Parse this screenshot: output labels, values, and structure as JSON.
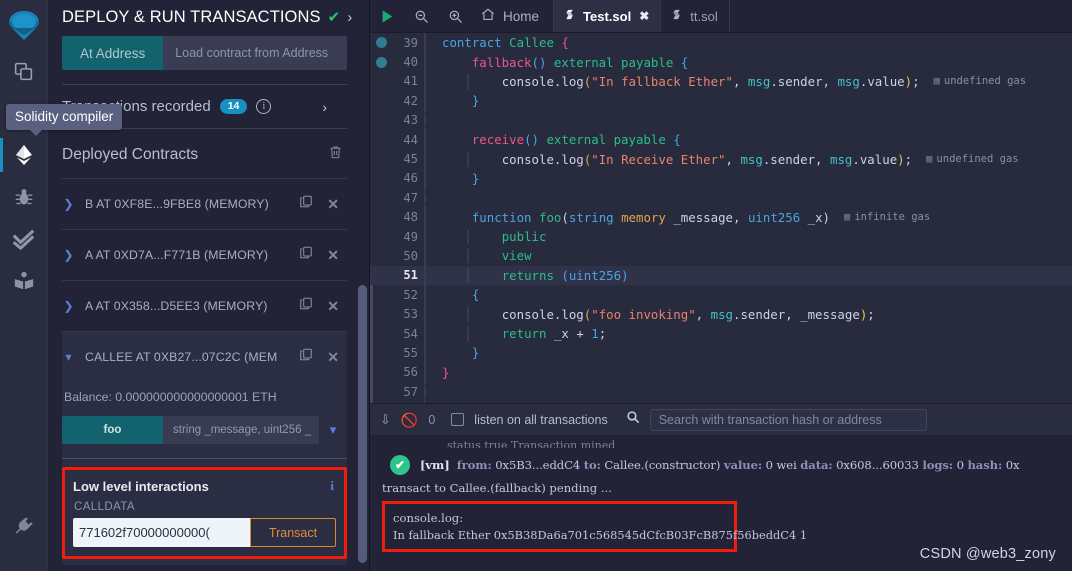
{
  "theme": {
    "accent_teal": "#13636f",
    "accent_blue": "#1790c4",
    "highlight_red": "#f01c0e",
    "success_green": "#2fc48b",
    "panel_bg": "#222336",
    "rail_bg": "#2a2c3f",
    "editor_bg": "#282a3e",
    "transact_orange": "#e08b3d"
  },
  "rail": {
    "logo": "remix-logo-icon",
    "items": [
      {
        "name": "file-explorer-icon",
        "title": "File explorers",
        "active": false,
        "badge": null
      },
      {
        "name": "solidity-compiler-icon",
        "title": "Solidity compiler",
        "active": false,
        "badge": "check"
      },
      {
        "name": "deploy-run-icon",
        "title": "Deploy & run transactions",
        "active": true,
        "badge": null
      },
      {
        "name": "debugger-bug-icon",
        "title": "Debugger",
        "active": false,
        "badge": null
      },
      {
        "name": "unit-testing-checks-icon",
        "title": "Solidity unit testing",
        "active": false,
        "badge": null
      },
      {
        "name": "documentation-book-icon",
        "title": "Documentation",
        "active": false,
        "badge": null
      },
      {
        "name": "plugin-manager-plug-icon",
        "title": "Plugin manager",
        "active": false,
        "badge": null
      }
    ],
    "tooltip": "Solidity compiler"
  },
  "sidebar": {
    "title": "DEPLOY & RUN TRANSACTIONS",
    "title_check": "✔",
    "title_chevron": "›",
    "at_address_button": "At Address",
    "at_address_placeholder": "Load contract from Address",
    "transactions_recorded_label": "Transactions recorded",
    "transactions_recorded_count": "14",
    "transactions_info_icon": "i",
    "transactions_chevron": "›",
    "deployed_contracts_label": "Deployed Contracts",
    "trash_icon": "trash-icon",
    "contracts": [
      {
        "caret": "❯",
        "name": "B AT 0XF8E...9FBE8 (MEMORY)",
        "expanded": false
      },
      {
        "caret": "❯",
        "name": "A AT 0XD7A...F771B (MEMORY)",
        "expanded": false
      },
      {
        "caret": "❯",
        "name": "A AT 0X358...D5EE3 (MEMORY)",
        "expanded": false
      },
      {
        "caret": "❯",
        "name": "CALLEE AT 0XB27...07C2C (MEM",
        "expanded": true
      }
    ],
    "selected_contract": {
      "balance": "Balance: 0.000000000000000001 ETH",
      "function_button": "foo",
      "function_args_placeholder": "string _message, uint256 _",
      "args_chevron": "⌄"
    },
    "low_level": {
      "title": "Low level interactions",
      "info_icon": "i",
      "calldata_label": "CALLDATA",
      "calldata_value": "771602f70000000000(",
      "transact_button": "Transact"
    }
  },
  "tabbar": {
    "run_icon": "play-icon",
    "zoom_out_icon": "zoom-out-icon",
    "zoom_in_icon": "zoom-in-icon",
    "home_icon": "home-icon",
    "home_label": "Home",
    "tabs": [
      {
        "label": "Test.sol",
        "active": true,
        "closable": true,
        "icon": "solidity-file-icon",
        "close_glyph": "✖"
      },
      {
        "label": "tt.sol",
        "active": false,
        "closable": false,
        "icon": "solidity-file-icon",
        "close_glyph": ""
      }
    ]
  },
  "editor": {
    "current_line": 51,
    "breakpoint_lines": [
      39,
      40
    ],
    "gas_hints": {
      "line41": "undefined gas",
      "line45": "undefined gas",
      "line48": "infinite gas"
    },
    "lines": [
      {
        "n": 39,
        "text": "contract Callee {"
      },
      {
        "n": 40,
        "text": "    fallback() external payable {"
      },
      {
        "n": 41,
        "text": "        console.log(\"In fallback Ether\", msg.sender, msg.value);"
      },
      {
        "n": 42,
        "text": "    }"
      },
      {
        "n": 43,
        "text": ""
      },
      {
        "n": 44,
        "text": "    receive() external payable {"
      },
      {
        "n": 45,
        "text": "        console.log(\"In Receive Ether\", msg.sender, msg.value);"
      },
      {
        "n": 46,
        "text": "    }"
      },
      {
        "n": 47,
        "text": ""
      },
      {
        "n": 48,
        "text": "    function foo(string memory _message, uint256 _x)"
      },
      {
        "n": 49,
        "text": "        public"
      },
      {
        "n": 50,
        "text": "        view"
      },
      {
        "n": 51,
        "text": "        returns (uint256)"
      },
      {
        "n": 52,
        "text": "    {"
      },
      {
        "n": 53,
        "text": "        console.log(\"foo invoking\", msg.sender, _message);"
      },
      {
        "n": 54,
        "text": "        return _x + 1;"
      },
      {
        "n": 55,
        "text": "    }"
      },
      {
        "n": 56,
        "text": "}"
      },
      {
        "n": 57,
        "text": ""
      }
    ]
  },
  "terminal": {
    "collapse_icon": "chevrons-down-icon",
    "clear_icon": "no-entry-icon",
    "pending_count": "0",
    "listen_label": "listen on all transactions",
    "listen_checked": false,
    "search_icon": "search-icon",
    "search_placeholder": "Search with transaction hash or address",
    "search_value": "",
    "tx_entry": {
      "status": "✔",
      "vm": "[vm]",
      "from_label": "from:",
      "from_value": "0x5B3...eddC4",
      "to_label": "to:",
      "to_value": "Callee.(constructor)",
      "value_label": "value:",
      "value_value": "0 wei",
      "data_label": "data:",
      "data_value": "0x608...60033",
      "logs_label": "logs:",
      "logs_value": "0",
      "hash_label": "hash:",
      "hash_value": "0x"
    },
    "pending_text": "transact to Callee.(fallback) pending ...",
    "console": {
      "title": "console.log",
      "title_colon": ":",
      "line": "In fallback Ether 0x5B38Da6a701c568545dCfcB03FcB875f56beddC4 1"
    },
    "watermark": "CSDN @web3_zony"
  }
}
